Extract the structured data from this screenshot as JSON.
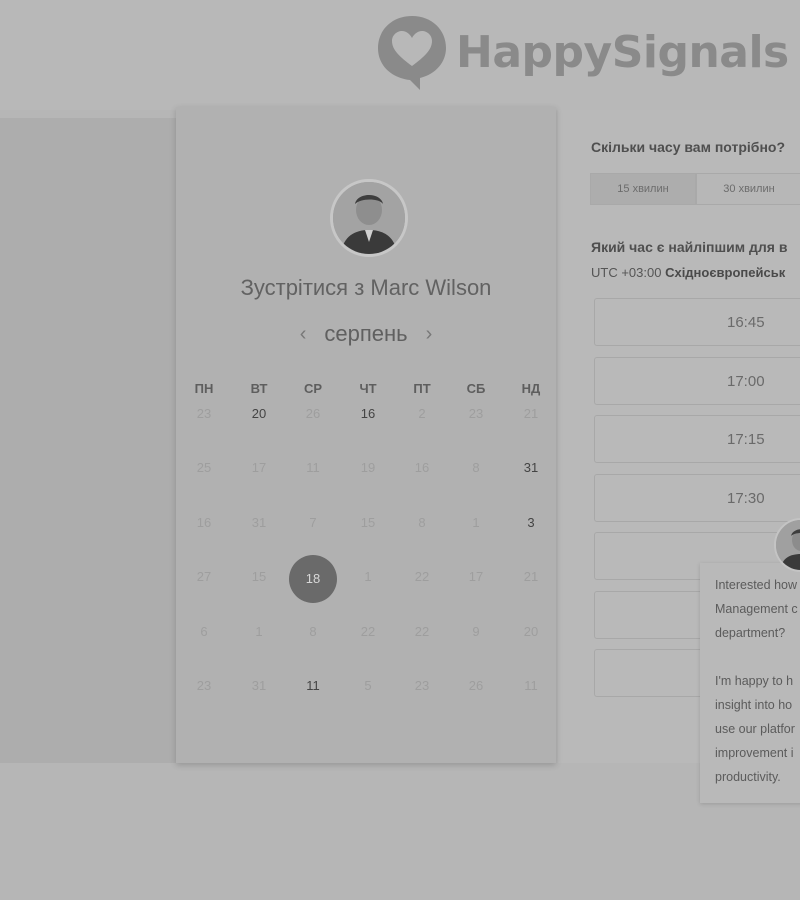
{
  "brand": {
    "name": "HappySignals"
  },
  "calendar": {
    "title": "Зустрітися з Marc Wilson",
    "month": "серпень",
    "prev_icon": "‹",
    "next_icon": "›",
    "weekdays": [
      "ПН",
      "ВТ",
      "СР",
      "ЧТ",
      "ПТ",
      "СБ",
      "НД"
    ],
    "weeks": [
      [
        "23",
        "20",
        "26",
        "16",
        "2",
        "23",
        "21"
      ],
      [
        "25",
        "17",
        "11",
        "19",
        "16",
        "8",
        "31"
      ],
      [
        "16",
        "31",
        "7",
        "15",
        "8",
        "1",
        "3"
      ],
      [
        "27",
        "15",
        "18",
        "1",
        "22",
        "17",
        "21"
      ],
      [
        "6",
        "1",
        "8",
        "22",
        "22",
        "9",
        "20"
      ],
      [
        "23",
        "31",
        "11",
        "5",
        "23",
        "26",
        "11"
      ]
    ],
    "active_days": [
      [
        0,
        1
      ],
      [
        0,
        3
      ],
      [
        1,
        6
      ],
      [
        2,
        6
      ],
      [
        5,
        2
      ]
    ],
    "selected_day": [
      3,
      2
    ]
  },
  "booking": {
    "duration_question": "Скільки часу вам потрібно?",
    "durations": [
      "15 хвилин",
      "30 хвилин"
    ],
    "time_question": "Який час є найліпшим для в",
    "timezone_prefix": "UTC +03:00",
    "timezone_name": "Східноєвропейськ",
    "slots": [
      "16:45",
      "17:00",
      "17:15",
      "17:30",
      "",
      "",
      ""
    ]
  },
  "chat": {
    "message": "Interested how\nManagement c\ndepartment?\n\nI'm happy to h\ninsight into ho\nuse our platfor\nimprovement i\nproductivity."
  },
  "colors": {
    "selected_day": "#6a6a6a",
    "overlay_gray": "#b6b6b6"
  }
}
